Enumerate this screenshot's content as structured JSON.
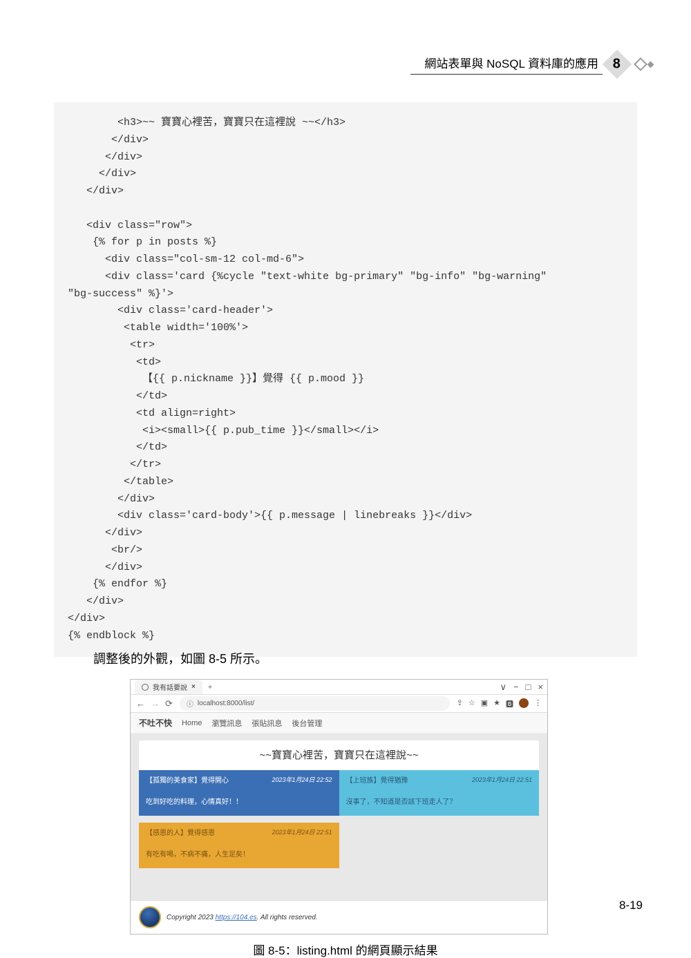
{
  "header": {
    "title": "網站表單與 NoSQL 資料庫的應用",
    "chapter": "8"
  },
  "code": "        <h3>~~ 寶寶心裡苦，寶寶只在這裡說 ~~</h3>\n       </div>\n      </div>\n     </div>\n   </div>\n\n   <div class=\"row\">\n    {% for p in posts %}\n      <div class=\"col-sm-12 col-md-6\">\n      <div class='card {%cycle \"text-white bg-primary\" \"bg-info\" \"bg-warning\"\n\"bg-success\" %}'>\n        <div class='card-header'>\n         <table width='100%'>\n          <tr>\n           <td>\n            【{{ p.nickname }}】覺得 {{ p.mood }}\n           </td>\n           <td align=right>\n            <i><small>{{ p.pub_time }}</small></i>\n           </td>\n          </tr>\n         </table>\n        </div>\n        <div class='card-body'>{{ p.message | linebreaks }}</div>\n      </div>\n       <br/>\n      </div>\n    {% endfor %}\n   </div>\n</div>\n{% endblock %}",
  "body_text": "調整後的外觀，如圖 8-5 所示。",
  "screenshot": {
    "tab_title": "我有話要說",
    "plus": "+",
    "url_prefix": "ⓘ",
    "url": "localhost:8000/list/",
    "window_controls": {
      "min": "−",
      "max": "□",
      "close": "×",
      "chevron": "∨"
    },
    "addr_icons": {
      "share": "⇪",
      "star": "☆",
      "ext1": "▣",
      "ext2": "★",
      "bookmark": "🅱",
      "menu": "⋮"
    },
    "nav_back": "←",
    "nav_fwd": "→",
    "nav_reload": "⟳",
    "brand": "不吐不快",
    "menu": [
      "Home",
      "瀏覽訊息",
      "張貼訊息",
      "後台管理"
    ],
    "hero": "~~寶寶心裡苦，寶寶只在這裡說~~",
    "posts": [
      {
        "nickname": "孤獨的美食家",
        "mood": "開心",
        "time": "2023年1月24日 22:52",
        "message": "吃到好吃的料理，心情真好！！",
        "bg": "bg-primary"
      },
      {
        "nickname": "上班族",
        "mood": "猶豫",
        "time": "2023年1月24日 22:51",
        "message": "沒事了，不知道是否該下班走人了？",
        "bg": "bg-info"
      },
      {
        "nickname": "感恩的人",
        "mood": "感恩",
        "time": "2023年1月24日 22:51",
        "message": "有吃有喝，不病不痛，人生足矣！",
        "bg": "bg-warning"
      }
    ],
    "footer": {
      "copyright_pre": "Copyright 2023 ",
      "link": "https://104.es",
      "copyright_post": ". All rights reserved."
    }
  },
  "figure_caption": "圖 8-5：listing.html 的網頁顯示結果",
  "page_number": "8-19"
}
